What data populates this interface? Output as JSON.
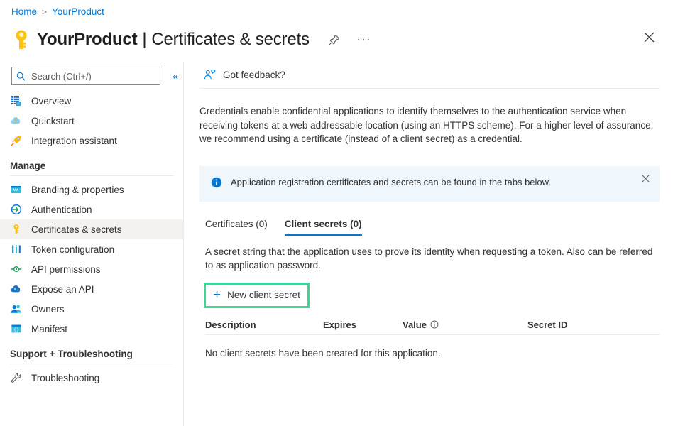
{
  "breadcrumb": {
    "home": "Home",
    "separator": ">",
    "current": "YourProduct"
  },
  "header": {
    "product": "YourProduct",
    "divider": "|",
    "section": "Certificates & secrets",
    "pin_icon": "pin-icon",
    "more_icon": "ellipsis-icon",
    "close_icon": "close-icon",
    "key_icon": "key-icon"
  },
  "sidebar": {
    "search": {
      "placeholder": "Search (Ctrl+/)",
      "value": "",
      "icon": "search-icon"
    },
    "collapse_icon": "chevron-double-left-icon",
    "top_items": [
      {
        "label": "Overview",
        "icon": "grid-icon",
        "active": false
      },
      {
        "label": "Quickstart",
        "icon": "cloud-lightning-icon",
        "active": false
      },
      {
        "label": "Integration assistant",
        "icon": "rocket-icon",
        "active": false
      }
    ],
    "groups": [
      {
        "title": "Manage",
        "items": [
          {
            "label": "Branding & properties",
            "icon": "branding-icon",
            "active": false
          },
          {
            "label": "Authentication",
            "icon": "authentication-icon",
            "active": false
          },
          {
            "label": "Certificates & secrets",
            "icon": "key-icon",
            "active": true
          },
          {
            "label": "Token configuration",
            "icon": "token-icon",
            "active": false
          },
          {
            "label": "API permissions",
            "icon": "api-permissions-icon",
            "active": false
          },
          {
            "label": "Expose an API",
            "icon": "expose-api-icon",
            "active": false
          },
          {
            "label": "Owners",
            "icon": "owners-icon",
            "active": false
          },
          {
            "label": "Manifest",
            "icon": "manifest-icon",
            "active": false
          }
        ]
      },
      {
        "title": "Support + Troubleshooting",
        "items": [
          {
            "label": "Troubleshooting",
            "icon": "wrench-icon",
            "active": false
          }
        ]
      }
    ]
  },
  "main": {
    "feedback": {
      "label": "Got feedback?",
      "icon": "person-feedback-icon"
    },
    "description": "Credentials enable confidential applications to identify themselves to the authentication service when receiving tokens at a web addressable location (using an HTTPS scheme). For a higher level of assurance, we recommend using a certificate (instead of a client secret) as a credential.",
    "info_banner": {
      "text": "Application registration certificates and secrets can be found in the tabs below.",
      "icon": "info-icon",
      "close_icon": "close-icon",
      "background": "#eff6fc"
    },
    "tabs": [
      {
        "label": "Certificates (0)",
        "active": false
      },
      {
        "label": "Client secrets (0)",
        "active": true
      }
    ],
    "tab_description": "A secret string that the application uses to prove its identity when requesting a token. Also can be referred to as application password.",
    "new_secret_button": {
      "label": "New client secret",
      "icon": "plus-icon",
      "highlight_color": "#3ed598"
    },
    "table": {
      "columns": [
        "Description",
        "Expires",
        "Value",
        "Secret ID"
      ],
      "value_info_icon": "info-circle-icon",
      "rows": [],
      "empty_message": "No client secrets have been created for this application."
    }
  },
  "colors": {
    "accent": "#0078d4",
    "link": "#0078d4",
    "highlight_green": "#3ed598",
    "banner_bg": "#eff6fc",
    "active_nav_bg": "#f3f2f1",
    "key_gold": "#ffb900"
  }
}
